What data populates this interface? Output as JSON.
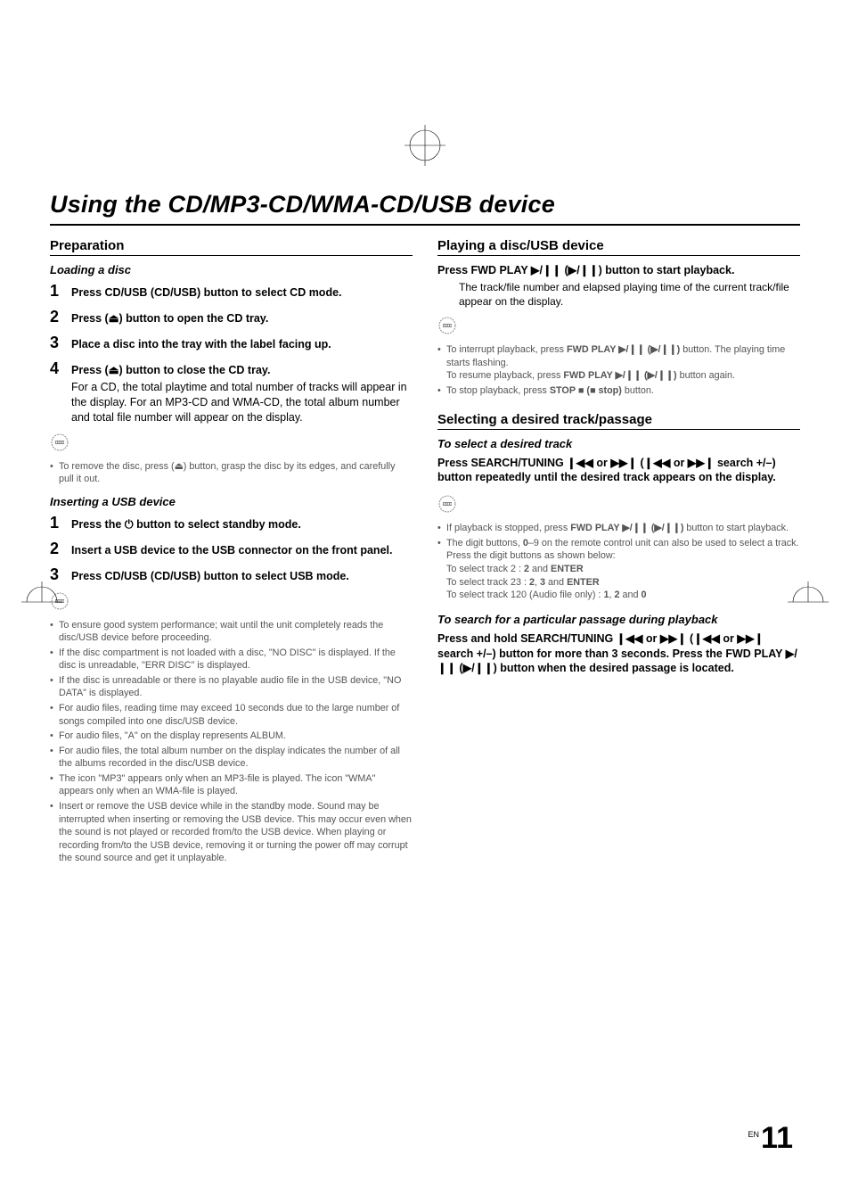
{
  "page": {
    "title": "Using the CD/MP3-CD/WMA-CD/USB device",
    "number_label": "EN",
    "number": "11"
  },
  "glyphs": {
    "eject": "⏏",
    "power": "⏻",
    "play_pause": "▶/❙❙",
    "play_pause_paren": "(▶/❙❙)",
    "stop": "■",
    "stop_paren": "(■ stop)",
    "prev": "❙◀◀",
    "next": "▶▶❙",
    "prev_paren": "(❙◀◀",
    "next_paren": "▶▶❙"
  },
  "left": {
    "preparation": {
      "title": "Preparation",
      "loading_head": "Loading a disc",
      "step1": "Press CD/USB (CD/USB) button to select CD mode.",
      "step2": "Press (⏏) button to open the CD tray.",
      "step3": "Place a disc into the tray with the label facing up.",
      "step4": "Press (⏏) button to close the CD tray.",
      "step4_cont": "For a CD, the total playtime and total number of tracks will appear in the display.\nFor an MP3-CD and WMA-CD, the total album number and total file number will appear on the display.",
      "note1": "To remove the disc, press (⏏) button, grasp the disc by its edges, and carefully pull it out.",
      "usb_head": "Inserting a USB device",
      "usb_step1": "Press the ⏻ button to select standby mode.",
      "usb_step2": "Insert a USB device to the USB connector on the front panel.",
      "usb_step3": "Press CD/USB (CD/USB) button to select USB mode.",
      "notes": [
        "To ensure good system performance; wait until the unit completely reads the disc/USB device before proceeding.",
        "If the disc compartment is not loaded with a disc, \"NO DISC\" is displayed. If the disc is unreadable, \"ERR DISC\" is displayed.",
        "If the disc is unreadable or there is no playable audio file in the USB device, \"NO DATA\" is displayed.",
        "For audio files, reading time may exceed 10 seconds due to the large number of songs compiled into one disc/USB device.",
        "For audio files, \"A\" on the display represents ALBUM.",
        "For audio files, the total album number on the display indicates the number of all the albums recorded in the disc/USB device.",
        "The icon \"MP3\" appears only when an MP3-file is played. The icon \"WMA\" appears only when an WMA-file is played.",
        "Insert or remove the USB device while in the standby mode. Sound may be interrupted when inserting or removing the USB device. This may occur even when the sound is not played or recorded from/to the USB device.\nWhen playing or recording from/to the USB device, removing it or turning the power off may corrupt the sound source and get it unplayable."
      ]
    }
  },
  "right": {
    "playing": {
      "title": "Playing a disc/USB device",
      "instr_pre": "Press FWD PLAY ",
      "instr_post": " button to start playback.",
      "instr_indent": "The track/file number and elapsed playing time of the current track/file appear on the display.",
      "notes": [
        {
          "pre": "To interrupt playback, press ",
          "bold1": "FWD PLAY ▶/❙❙ (▶/❙❙)",
          "mid": " button. The playing time starts flashing.\nTo resume playback, press ",
          "bold2": "FWD PLAY ▶/❙❙ (▶/❙❙)",
          "post": " button again."
        },
        {
          "pre": "To stop playback, press ",
          "bold1": "STOP ■ (■ stop)",
          "post": " button."
        }
      ]
    },
    "selecting": {
      "title": "Selecting a desired track/passage",
      "track_head": "To select a desired track",
      "track_instr": "Press SEARCH/TUNING ❙◀◀ or ▶▶❙ (❙◀◀ or ▶▶❙ search +/–) button repeatedly until the desired track appears on the display.",
      "notes": [
        {
          "pre": "If playback is stopped, press ",
          "bold1": "FWD PLAY ▶/❙❙ (▶/❙❙)",
          "post": " button to start playback."
        },
        {
          "text": "The digit buttons, 0–9 on the remote control unit can also be used to select a track.\nPress the digit buttons as shown below:\nTo select track 2 : 2 and ENTER\nTo select track 23 : 2, 3 and ENTER\nTo select track 120 (Audio file only) : 1, 2 and 0",
          "bold_words": [
            "2",
            "ENTER",
            "2",
            "3",
            "ENTER",
            "1",
            "2",
            "0"
          ]
        }
      ],
      "search_head": "To search for a particular passage during playback",
      "search_instr": "Press and hold SEARCH/TUNING ❙◀◀ or ▶▶❙ (❙◀◀ or ▶▶❙ search +/–) button for more than 3 seconds. Press the FWD PLAY ▶/❙❙ (▶/❙❙) button when the desired passage is located."
    }
  }
}
